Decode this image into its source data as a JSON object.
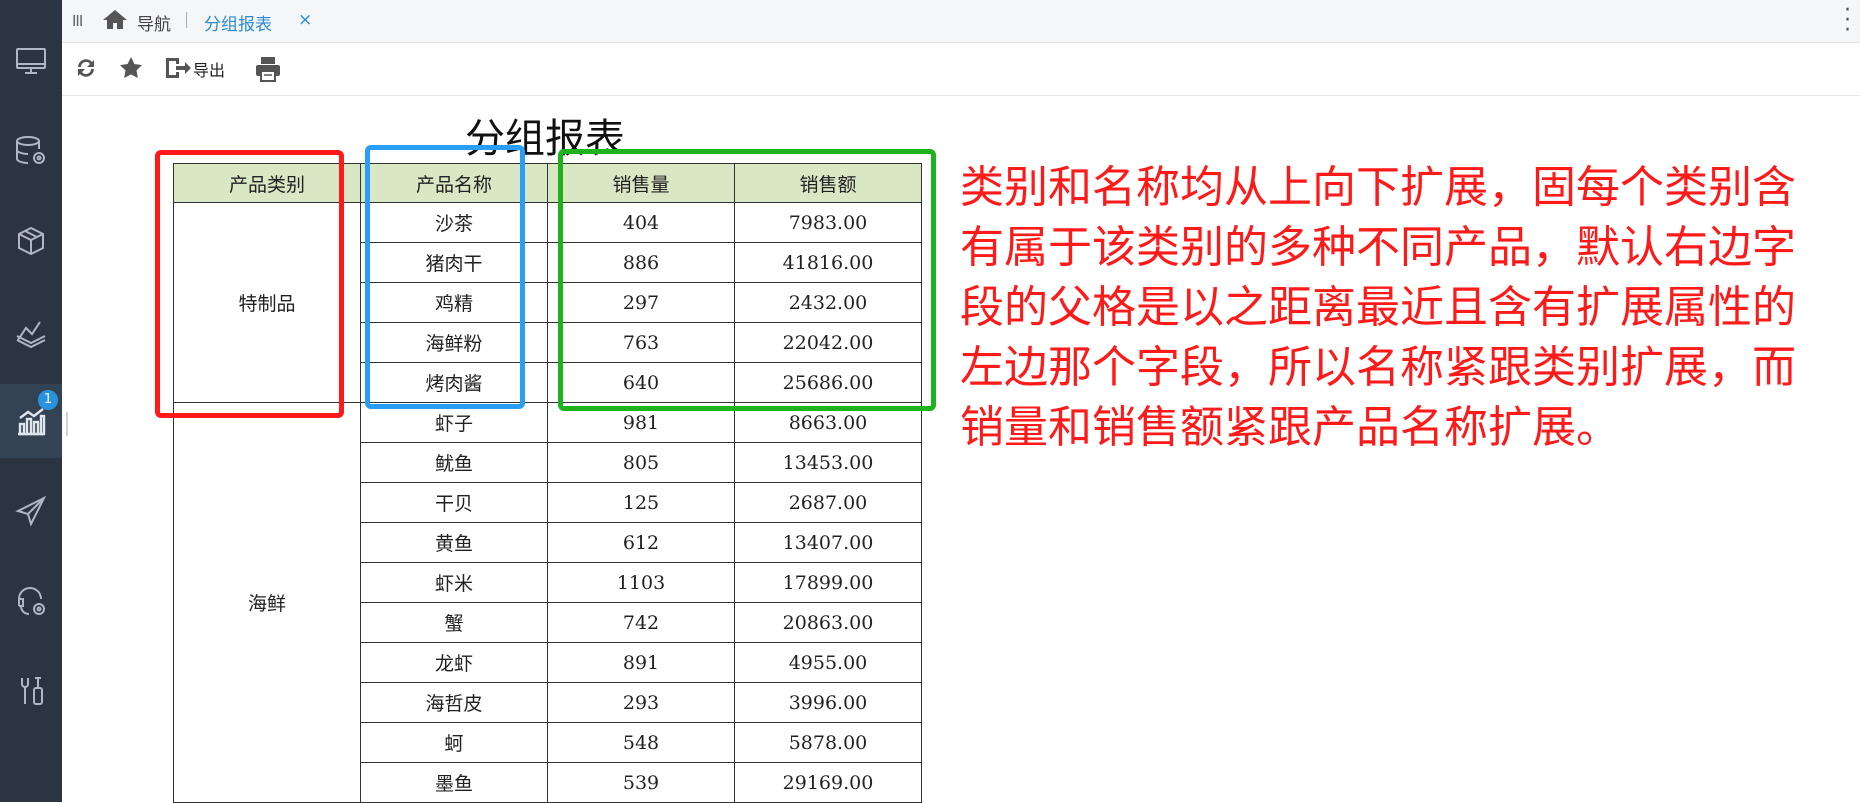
{
  "sidebar": {
    "items": [
      {
        "icon": "monitor-icon"
      },
      {
        "icon": "database-gear-icon"
      },
      {
        "icon": "cube-icon"
      },
      {
        "icon": "layers-chart-icon"
      },
      {
        "icon": "bar-chart-icon",
        "badge": "1",
        "active": true
      },
      {
        "icon": "send-icon"
      },
      {
        "icon": "support-gear-icon"
      },
      {
        "icon": "tools-icon"
      }
    ]
  },
  "tabs": {
    "nav_label": "导航",
    "active_tab": "分组报表",
    "close_glyph": "×"
  },
  "toolbar": {
    "export_label": "导出"
  },
  "report": {
    "title": "分组报表",
    "headers": [
      "产品类别",
      "产品名称",
      "销售量",
      "销售额"
    ],
    "groups": [
      {
        "category": "特制品",
        "rows": [
          [
            "沙茶",
            "404",
            "7983.00"
          ],
          [
            "猪肉干",
            "886",
            "41816.00"
          ],
          [
            "鸡精",
            "297",
            "2432.00"
          ],
          [
            "海鲜粉",
            "763",
            "22042.00"
          ],
          [
            "烤肉酱",
            "640",
            "25686.00"
          ]
        ]
      },
      {
        "category": "海鲜",
        "rows": [
          [
            "虾子",
            "981",
            "8663.00"
          ],
          [
            "鱿鱼",
            "805",
            "13453.00"
          ],
          [
            "干贝",
            "125",
            "2687.00"
          ],
          [
            "黄鱼",
            "612",
            "13407.00"
          ],
          [
            "虾米",
            "1103",
            "17899.00"
          ],
          [
            "蟹",
            "742",
            "20863.00"
          ],
          [
            "龙虾",
            "891",
            "4955.00"
          ],
          [
            "海哲皮",
            "293",
            "3996.00"
          ],
          [
            "蚵",
            "548",
            "5878.00"
          ],
          [
            "墨鱼",
            "539",
            "29169.00"
          ]
        ]
      }
    ]
  },
  "annotation": {
    "lines": [
      "类别和名称均从上向下扩展，固每个类别含",
      "有属于该类别的多种不同产品，默认右边字",
      "段的父格是以之距离最近且含有扩展属性的",
      "左边那个字段，所以名称紧跟类别扩展，而",
      "销量和销售额紧跟产品名称扩展。"
    ]
  },
  "colors": {
    "sidebar_bg": "#2b3441",
    "header_bg": "#d9e7c5",
    "tab_accent": "#2a8bd6",
    "annotation": "#ff1a1a",
    "box_red": "#ff1a1a",
    "box_blue": "#2a9df4",
    "box_green": "#1db31d"
  }
}
